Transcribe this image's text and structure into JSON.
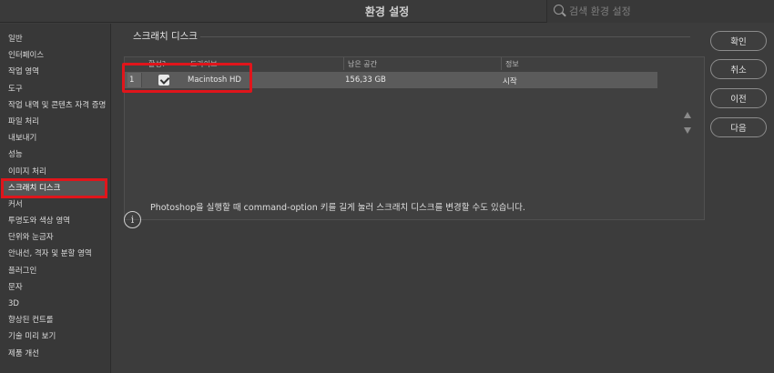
{
  "window": {
    "title": "환경 설정"
  },
  "search": {
    "placeholder": "검색 환경 설정"
  },
  "sidebar": {
    "items": [
      "일반",
      "인터페이스",
      "작업 영역",
      "도구",
      "작업 내역 및 콘텐츠 자격 증명",
      "파일 처리",
      "내보내기",
      "성능",
      "이미지 처리",
      "스크래치 디스크",
      "커서",
      "투명도와 색상 영역",
      "단위와 눈금자",
      "안내선, 격자 및 분할 영역",
      "플러그인",
      "문자",
      "3D",
      "향상된 컨트롤",
      "기술 미리 보기",
      "제품 개선"
    ],
    "selected_index": 9
  },
  "section": {
    "title": "스크래치 디스크"
  },
  "table": {
    "headers": {
      "active": "활성?",
      "drive": "드라이브",
      "free_space": "남은 공간",
      "info": "정보"
    },
    "rows": [
      {
        "index": "1",
        "active": true,
        "drive": "Macintosh HD",
        "free_space": "156,33 GB",
        "info": "시작"
      }
    ]
  },
  "info": {
    "text": "Photoshop을 실행할 때 command-option 키를 길게 눌러 스크래치 디스크를 변경할 수도 있습니다."
  },
  "buttons": {
    "ok": "확인",
    "cancel": "취소",
    "prev": "이전",
    "next": "다음"
  },
  "colors": {
    "highlight": "#e0151b",
    "background": "#3c3c3c"
  }
}
